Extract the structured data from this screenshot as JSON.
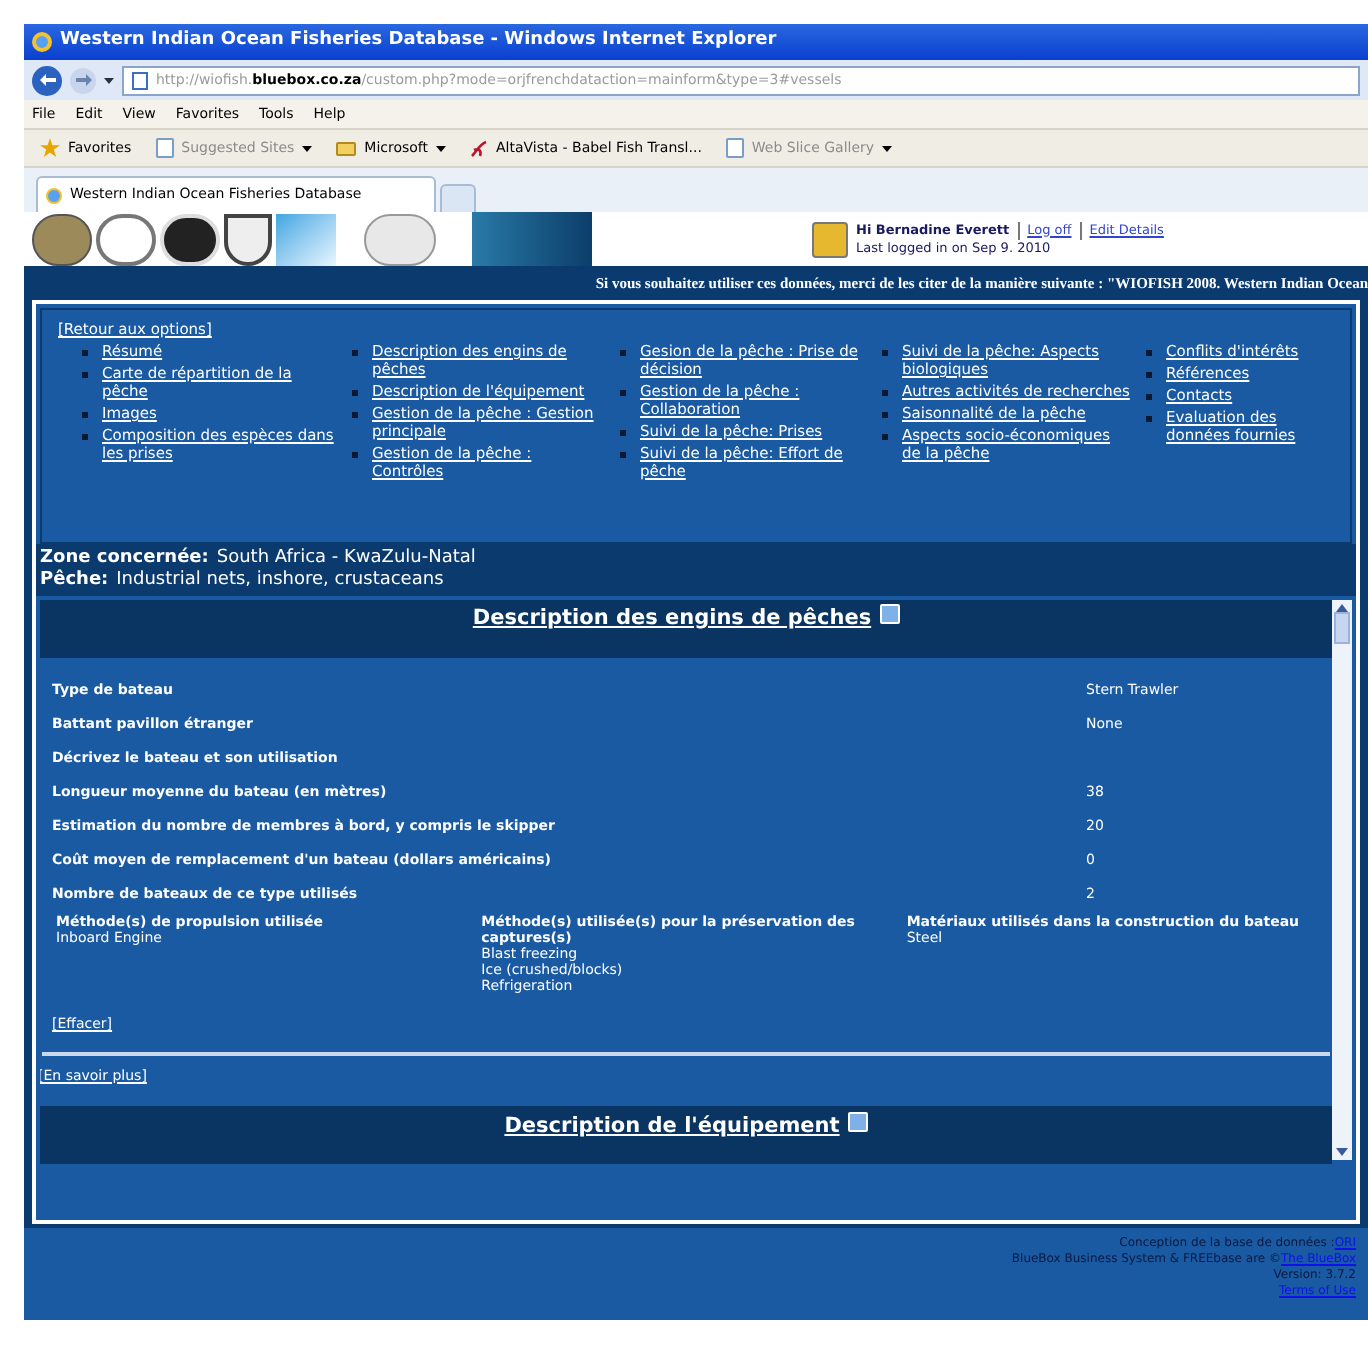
{
  "window": {
    "title": "Western Indian Ocean Fisheries Database - Windows Internet Explorer"
  },
  "address_bar": {
    "url": "http://wiofish.**bluebox.co.za**/custom.php?mode=orjfrenchdataction=mainform&type=3#vessels"
  },
  "menu": [
    "File",
    "Edit",
    "View",
    "Favorites",
    "Tools",
    "Help"
  ],
  "favorites_bar": [
    {
      "label": "Favorites",
      "kind": "favorites"
    },
    {
      "label": "Suggested Sites",
      "kind": "dropdown_dim"
    },
    {
      "label": "Microsoft",
      "kind": "folder"
    },
    {
      "label": "AltaVista - Babel Fish Transl...",
      "kind": "link"
    },
    {
      "label": "Web Slice Gallery",
      "kind": "dropdown_dim"
    }
  ],
  "tabs": [
    {
      "label": "Western Indian Ocean Fisheries Database",
      "selected": true
    }
  ],
  "user": {
    "greeting": "Hi Bernadine Everett",
    "links": [
      "Log off",
      "Edit Details"
    ],
    "last_login": "Last logged in on Sep 9. 2010"
  },
  "citation": "Si vous souhaitez utiliser ces données, merci de les citer de la manière suivante : \"WIOFISH 2008. Western Indian Ocean",
  "nav": {
    "back": "[Retour aux options]",
    "columns": [
      [
        "Résumé",
        "Carte de répartition de la pêche",
        "Images",
        "Composition des espèces dans les prises"
      ],
      [
        "Description des engins de pêches",
        "Description de l'équipement",
        "Gestion de la pêche : Gestion principale",
        "Gestion de la pêche : Contrôles"
      ],
      [
        "Gesion de la pêche : Prise de décision",
        "Gestion de la pêche : Collaboration",
        "Suivi de la pêche: Prises",
        "Suivi de la pêche: Effort de pêche"
      ],
      [
        "Suivi de la pêche: Aspects biologiques",
        "Autres activités de recherches",
        "Saisonnalité de la pêche",
        "Aspects socio-économiques de la pêche"
      ],
      [
        "Conflits d'intérêts",
        "Références",
        "Contacts",
        "Evaluation des données fournies"
      ]
    ]
  },
  "zone": [
    {
      "label": "Zone concernée:",
      "value": "South Africa - KwaZulu-Natal"
    },
    {
      "label": "Pêche:",
      "value": "Industrial nets, inshore, crustaceans"
    }
  ],
  "section": {
    "title": "Description des engins de pêches",
    "fields": [
      {
        "label": "Type de bateau",
        "value": "Stern Trawler"
      },
      {
        "label": "Battant pavillon étranger",
        "value": "None"
      },
      {
        "label": "Décrivez le bateau et son utilisation"
      },
      {
        "label": "Longueur moyenne du bateau (en mètres)",
        "value": "38"
      },
      {
        "label": "Estimation du nombre de membres à bord, y compris le skipper",
        "value": "20"
      },
      {
        "label": "Coût moyen de remplacement d'un bateau (dollars américains)",
        "value": "0"
      },
      {
        "label": "Nombre de bateaux de ce type utilisés",
        "value": "2"
      }
    ],
    "columns": [
      {
        "heading": "Méthode(s) de propulsion utilisée",
        "values": [
          "Inboard Engine"
        ]
      },
      {
        "heading": "Méthode(s) utilisée(s) pour la préservation des captures(s)",
        "values": [
          "Blast freezing",
          "Ice (crushed/blocks)",
          "Refrigeration"
        ]
      },
      {
        "heading": "Matériaux utilisés dans la construction du bateau",
        "values": [
          "Steel"
        ]
      }
    ],
    "clear": "[Effacer]"
  },
  "more": "[En savoir plus]",
  "section2": {
    "title": "Description de l'équipement"
  },
  "footer": [
    {
      "text": "Conception de la base de données : ",
      "link": "ORI"
    },
    {
      "text": "BlueBox Business System & FREEbase are © ",
      "link": "The BlueBox"
    },
    {
      "text": "Version: 3.7.2"
    },
    {
      "link": "Terms of Use"
    }
  ]
}
